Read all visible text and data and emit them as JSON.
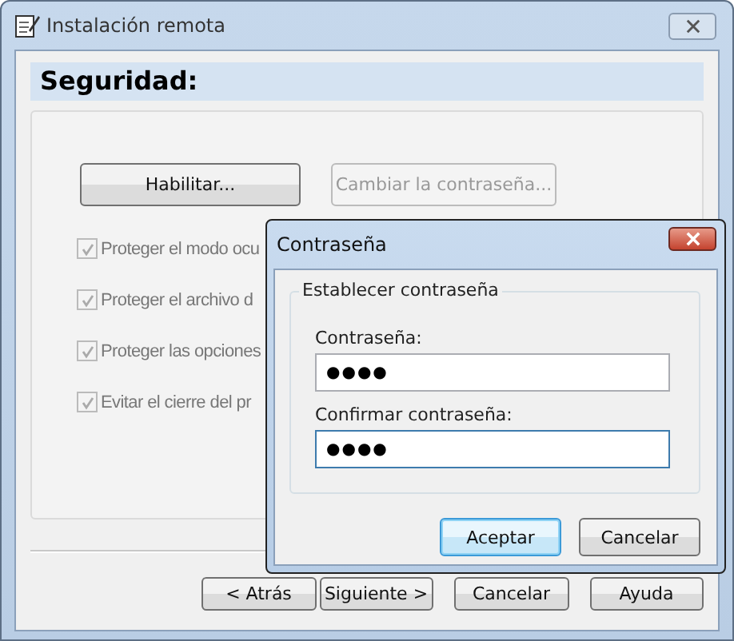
{
  "window": {
    "title": "Instalación remota"
  },
  "header": "Seguridad:",
  "actions": [
    {
      "label": "Habilitar...",
      "disabled": false
    },
    {
      "label": "Cambiar la contraseña...",
      "disabled": true
    }
  ],
  "options": [
    {
      "label": "Proteger el modo ocu",
      "checked": true,
      "disabled": true
    },
    {
      "label": "Proteger el archivo d",
      "checked": true,
      "disabled": true
    },
    {
      "label": "Proteger las opciones",
      "checked": true,
      "disabled": true
    },
    {
      "label": "Evitar el cierre del pr",
      "checked": true,
      "disabled": true
    }
  ],
  "buttons": [
    {
      "label": "< Atrás",
      "default": false
    },
    {
      "label": "Siguiente >",
      "default": false
    },
    {
      "label": "Cancelar",
      "default": false
    },
    {
      "label": "Ayuda",
      "default": false
    }
  ],
  "dialog": {
    "title": "Contraseña",
    "group": "Establecer contraseña",
    "fields": [
      {
        "label": "Contraseña:",
        "value": "●●●●",
        "focused": false
      },
      {
        "label": "Confirmar contraseña:",
        "value": "●●●●",
        "focused": true
      }
    ],
    "buttons": [
      {
        "label": "Aceptar",
        "default": true
      },
      {
        "label": "Cancelar",
        "default": false
      }
    ]
  }
}
